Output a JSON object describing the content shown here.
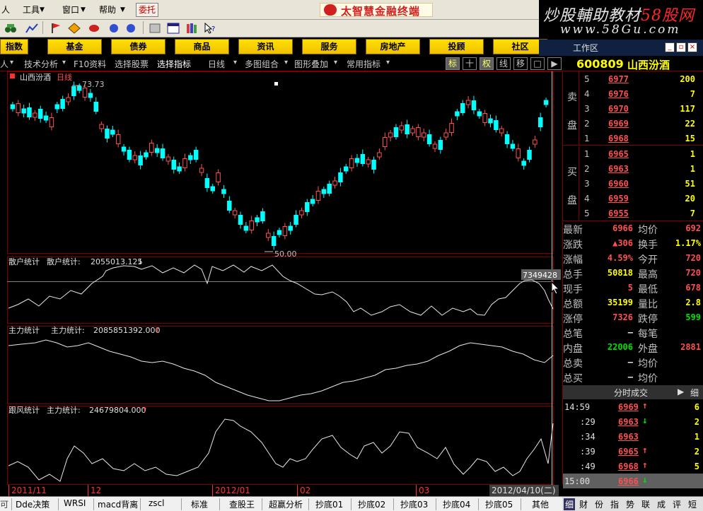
{
  "menu": {
    "items": [
      "人",
      "工具",
      "窗口",
      "帮助"
    ],
    "weituo_label": "委托",
    "brand_text": "太智慧金融终端"
  },
  "watermark": {
    "line1_main": "炒股輔助教材",
    "line1_brand": "58股网",
    "line2": "www.58Gu.com"
  },
  "categories": [
    "指数",
    "基金",
    "债券",
    "商品",
    "资讯",
    "服务",
    "房地产",
    "投顾",
    "社区"
  ],
  "workspace": {
    "label": "工作区"
  },
  "function_tabs": {
    "items": [
      "人",
      "技术分析",
      "F10资料",
      "选择股票",
      "选择指标",
      "日线",
      "多图组合",
      "图形叠加",
      "常用指标"
    ],
    "squares": [
      "标",
      "十",
      "权",
      "线",
      "移",
      "□",
      "▶"
    ]
  },
  "stock": {
    "code": "600809",
    "name": "山西汾酒",
    "chart_title": "山西汾酒",
    "chart_period": "日线",
    "high_label": "73.73",
    "low_label": "50.00"
  },
  "indicators": {
    "retail": {
      "name": "散户统计",
      "label": "散户统计:",
      "value": "2055013.125",
      "arrow": "↓"
    },
    "main": {
      "name": "主力统计",
      "label": "主力统计:",
      "value": "2085851392.000",
      "arrow": "↑"
    },
    "follow": {
      "name": "跟风统计",
      "label": "主力统计:",
      "value": "24679804.000",
      "arrow": "↑"
    },
    "cursor_value": "7349428"
  },
  "orderbook": {
    "sell_side_label_1": "卖",
    "sell_side_label_2": "盘",
    "buy_side_label_1": "买",
    "buy_side_label_2": "盘",
    "sells": [
      {
        "level": "5",
        "price": "6977",
        "vol": "200"
      },
      {
        "level": "4",
        "price": "6976",
        "vol": "7"
      },
      {
        "level": "3",
        "price": "6970",
        "vol": "117"
      },
      {
        "level": "2",
        "price": "6969",
        "vol": "22"
      },
      {
        "level": "1",
        "price": "6968",
        "vol": "15"
      }
    ],
    "buys": [
      {
        "level": "1",
        "price": "6965",
        "vol": "1"
      },
      {
        "level": "2",
        "price": "6963",
        "vol": "1"
      },
      {
        "level": "3",
        "price": "6960",
        "vol": "51"
      },
      {
        "level": "4",
        "price": "6959",
        "vol": "20"
      },
      {
        "level": "5",
        "price": "6955",
        "vol": "7"
      }
    ]
  },
  "quotes": [
    {
      "k1": "最新",
      "v1": "6966",
      "c1": "red",
      "k2": "均价",
      "v2": "692",
      "c2": "red"
    },
    {
      "k1": "涨跌",
      "v1": "▲306",
      "c1": "red",
      "k2": "换手",
      "v2": "1.17%",
      "c2": "yel"
    },
    {
      "k1": "涨幅",
      "v1": "4.59%",
      "c1": "red",
      "k2": "今开",
      "v2": "720",
      "c2": "red"
    },
    {
      "k1": "总手",
      "v1": "50818",
      "c1": "yel",
      "k2": "最高",
      "v2": "720",
      "c2": "red"
    },
    {
      "k1": "现手",
      "v1": "5",
      "c1": "red",
      "k2": "最低",
      "v2": "678",
      "c2": "red"
    },
    {
      "k1": "总额",
      "v1": "35199",
      "c1": "yel",
      "k2": "量比",
      "v2": "2.8",
      "c2": "yel"
    },
    {
      "k1": "涨停",
      "v1": "7326",
      "c1": "red",
      "k2": "跌停",
      "v2": "599",
      "c2": "grn"
    },
    {
      "k1": "总笔",
      "v1": "–",
      "c1": "wht",
      "k2": "每笔",
      "v2": "",
      "c2": "wht"
    },
    {
      "k1": "内盘",
      "v1": "22006",
      "c1": "grn",
      "k2": "外盘",
      "v2": "2881",
      "c2": "red"
    },
    {
      "k1": "总卖",
      "v1": "–",
      "c1": "wht",
      "k2": "均价",
      "v2": "",
      "c2": "wht"
    },
    {
      "k1": "总买",
      "v1": "–",
      "c1": "wht",
      "k2": "均价",
      "v2": "",
      "c2": "wht"
    }
  ],
  "ticks": {
    "title": "分时成交",
    "arrow": "▶",
    "right_label": "细",
    "rows": [
      {
        "time": "14:59",
        "price": "6969",
        "dir": "↑",
        "dcol": "red",
        "vol": "6"
      },
      {
        "time": ":29",
        "price": "6963",
        "dir": "↓",
        "dcol": "grn",
        "vol": "2"
      },
      {
        "time": ":34",
        "price": "6963",
        "dir": "",
        "dcol": "red",
        "vol": "1"
      },
      {
        "time": ":39",
        "price": "6965",
        "dir": "↑",
        "dcol": "red",
        "vol": "2"
      },
      {
        "time": ":49",
        "price": "6968",
        "dir": "↑",
        "dcol": "red",
        "vol": "5"
      },
      {
        "time": "15:00",
        "price": "6966",
        "dir": "↓",
        "dcol": "grn",
        "vol": ""
      }
    ]
  },
  "bottom_dates": {
    "labels": [
      "2011/11",
      "12",
      "2012/01",
      "02",
      "03"
    ],
    "cursor": "2012/04/10(二)"
  },
  "bottom_tabs": [
    "Dde决策",
    "WRSI",
    "macd背离",
    "zscl",
    "标准",
    "查股王",
    "超赢分析",
    "抄底01",
    "抄底02",
    "抄底03",
    "抄底04",
    "抄底05",
    "其他"
  ],
  "bottom_right_tabs": [
    "细",
    "财",
    "份",
    "指",
    "势",
    "联",
    "成",
    "评",
    "短"
  ],
  "colors": {
    "up": "#ff5050",
    "down": "#00ffff",
    "frame": "#800000",
    "accent": "#ffff00"
  }
}
